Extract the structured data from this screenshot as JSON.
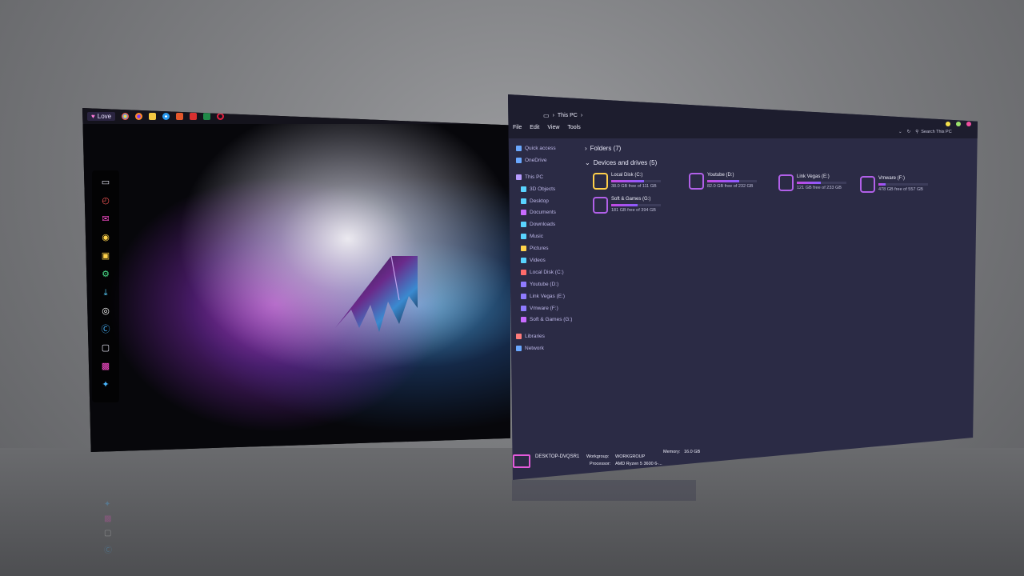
{
  "desktop": {
    "taskbar": {
      "love_label": "Love",
      "app_icons": [
        "chrome-icon",
        "firefox-icon",
        "folder-icon",
        "edge-icon",
        "powerpoint-icon",
        "acrobat-icon",
        "excel-icon",
        "opera-icon"
      ]
    },
    "dock_icons": [
      "monitor-icon",
      "clock-icon",
      "mail-icon",
      "chrome-icon",
      "gamepad-icon",
      "settings-icon",
      "download-icon",
      "music-icon",
      "skype-icon",
      "photos-icon",
      "image-editor-icon",
      "twitter-icon"
    ]
  },
  "explorer": {
    "breadcrumb": {
      "location": "This PC"
    },
    "menu": [
      "File",
      "Edit",
      "View",
      "Tools"
    ],
    "search_placeholder": "Search This PC",
    "traffic_colors": [
      "#f5e04a",
      "#9be26c",
      "#f04ea0"
    ],
    "nav": [
      {
        "label": "Quick access",
        "icon": "star-icon",
        "sub": false,
        "color": "#6aa8ff"
      },
      {
        "label": "OneDrive",
        "icon": "cloud-icon",
        "sub": false,
        "color": "#6aa8ff"
      },
      {
        "label": "This PC",
        "icon": "monitor-icon",
        "sub": false,
        "color": "#b69bff"
      },
      {
        "label": "3D Objects",
        "icon": "cube-icon",
        "sub": true,
        "color": "#59d4ff"
      },
      {
        "label": "Desktop",
        "icon": "desktop-icon",
        "sub": true,
        "color": "#59d4ff"
      },
      {
        "label": "Documents",
        "icon": "document-icon",
        "sub": true,
        "color": "#c86bff"
      },
      {
        "label": "Downloads",
        "icon": "download-icon",
        "sub": true,
        "color": "#59d4ff"
      },
      {
        "label": "Music",
        "icon": "music-icon",
        "sub": true,
        "color": "#59d4ff"
      },
      {
        "label": "Pictures",
        "icon": "picture-icon",
        "sub": true,
        "color": "#ffd34a"
      },
      {
        "label": "Videos",
        "icon": "video-icon",
        "sub": true,
        "color": "#59d4ff"
      },
      {
        "label": "Local Disk (C:)",
        "icon": "drive-icon",
        "sub": true,
        "color": "#ff6b6b"
      },
      {
        "label": "Youtube (D:)",
        "icon": "drive-icon",
        "sub": true,
        "color": "#8f7bff"
      },
      {
        "label": "Link Vegas (E:)",
        "icon": "drive-icon",
        "sub": true,
        "color": "#8f7bff"
      },
      {
        "label": "Vmware  (F:)",
        "icon": "drive-icon",
        "sub": true,
        "color": "#8f7bff"
      },
      {
        "label": "Soft & Games (G:)",
        "icon": "drive-icon",
        "sub": true,
        "color": "#c86bff"
      },
      {
        "label": "Libraries",
        "icon": "library-icon",
        "sub": false,
        "color": "#ff7b7b"
      },
      {
        "label": "Network",
        "icon": "network-icon",
        "sub": false,
        "color": "#6aa8ff"
      }
    ],
    "folders_header": "Folders (7)",
    "devices_header": "Devices and drives (5)",
    "drives": [
      {
        "name": "Local Disk (C:)",
        "free": "38.0 GB free of 111 GB",
        "used_fraction": 0.66
      },
      {
        "name": "Youtube (D:)",
        "free": "82.0 GB free of 232 GB",
        "used_fraction": 0.65
      },
      {
        "name": "Link Vegas (E:)",
        "free": "121 GB free of 233 GB",
        "used_fraction": 0.48
      },
      {
        "name": "Vmware  (F:)",
        "free": "478 GB free of 557 GB",
        "used_fraction": 0.14
      },
      {
        "name": "Soft & Games (G:)",
        "free": "181 GB free of 394 GB",
        "used_fraction": 0.54
      }
    ],
    "status": {
      "computer_name": "DESKTOP-DVQSR1",
      "workgroup_label": "Workgroup:",
      "workgroup_value": "WORKGROUP",
      "processor_label": "Processor:",
      "processor_value": "AMD Ryzen 5 3600 6-...",
      "memory_label": "Memory:",
      "memory_value": "16.0 GB"
    }
  }
}
